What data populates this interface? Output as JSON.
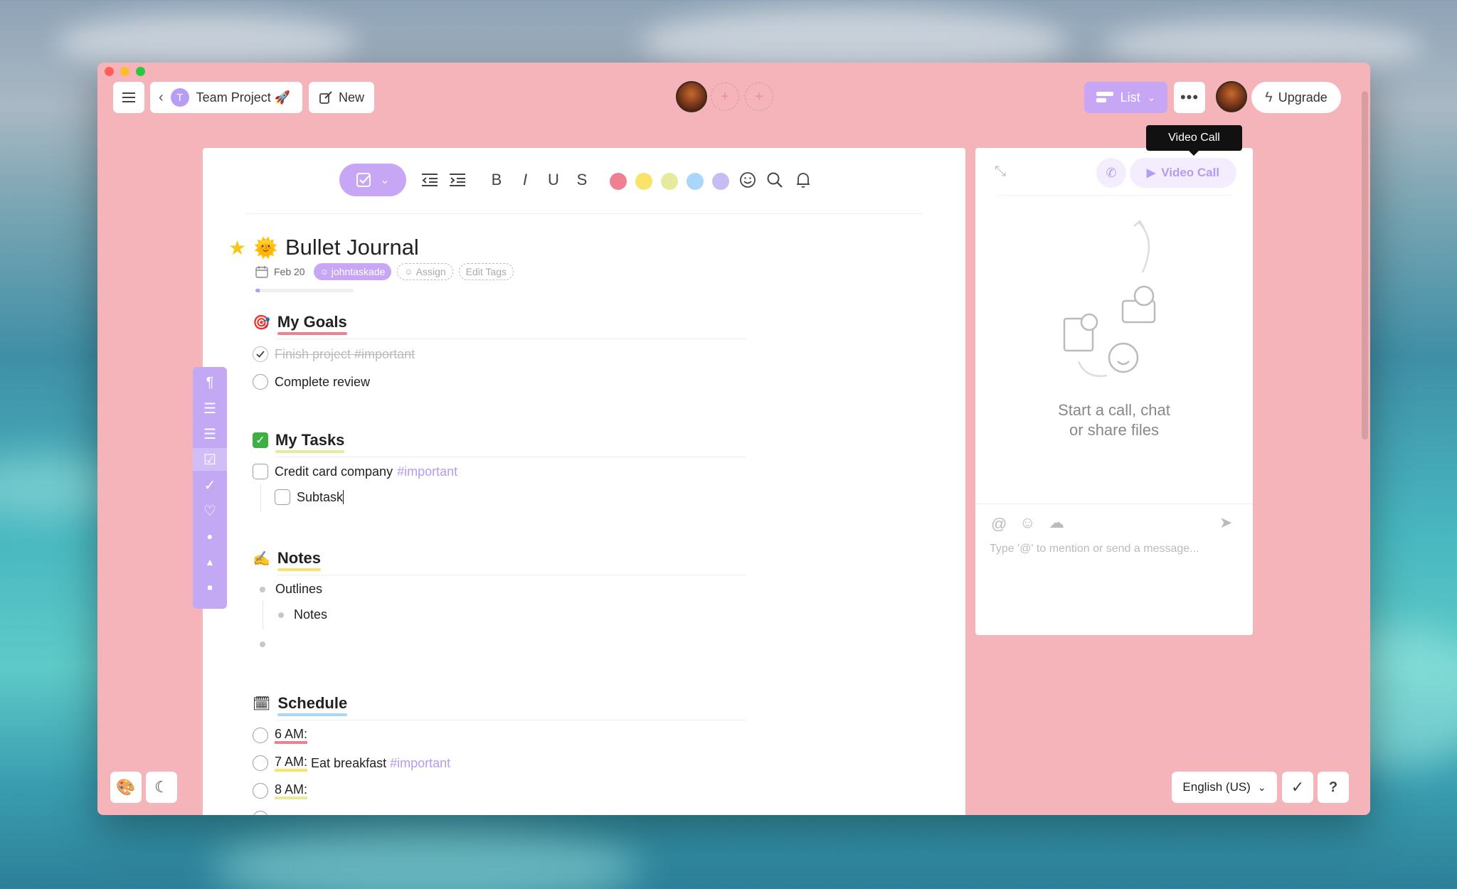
{
  "window": {
    "breadcrumb_initial": "T",
    "project_name": "Team Project 🚀",
    "new_label": "New",
    "view_label": "List",
    "upgrade_label": "Upgrade",
    "tooltip": "Video Call"
  },
  "toolbar": {
    "bold": "B",
    "italic": "I",
    "underline": "U",
    "strike": "S",
    "colors": [
      "#f07f91",
      "#f9e36b",
      "#e6ea9d",
      "#a9d6fb",
      "#c7bdf2"
    ]
  },
  "doc": {
    "title": "Bullet Journal",
    "date": "Feb 20",
    "user": "johntaskade",
    "assign": "Assign",
    "edit_tags": "Edit Tags",
    "progress": 0.04
  },
  "sections": {
    "goals": {
      "heading": "My Goals",
      "items": [
        "Finish project #important",
        "Complete review"
      ]
    },
    "tasks": {
      "heading": "My Tasks",
      "item": "Credit card company",
      "item_tag": "#important",
      "subtask": "Subtask"
    },
    "notes": {
      "heading": "Notes",
      "items": [
        "Outlines",
        "Notes"
      ]
    },
    "schedule": {
      "heading": "Schedule",
      "items": [
        {
          "time": "6 AM:",
          "text": "",
          "tag": ""
        },
        {
          "time": "7 AM:",
          "text": " Eat breakfast ",
          "tag": "#important"
        },
        {
          "time": "8 AM:",
          "text": "",
          "tag": ""
        }
      ]
    }
  },
  "chat": {
    "video_call_label": "Video Call",
    "empty_line1": "Start a call, chat",
    "empty_line2": "or share files",
    "placeholder": "Type '@' to mention or send a message..."
  },
  "footer": {
    "language": "English (US)",
    "help": "?"
  }
}
